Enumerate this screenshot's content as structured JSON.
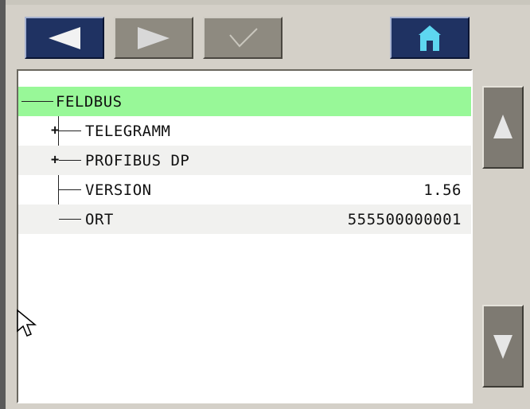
{
  "toolbar": {
    "back_icon": "arrow-left-icon",
    "forward_icon": "arrow-right-icon",
    "confirm_icon": "check-icon",
    "home_icon": "home-icon"
  },
  "tree": {
    "items": [
      {
        "label": "FELDBUS",
        "value": "",
        "selected": true,
        "expandable": false
      },
      {
        "label": "TELEGRAMM",
        "value": "",
        "selected": false,
        "expandable": true
      },
      {
        "label": "PROFIBUS DP",
        "value": "",
        "selected": false,
        "expandable": true
      },
      {
        "label": "VERSION",
        "value": "1.56",
        "selected": false,
        "expandable": false
      },
      {
        "label": "ORT",
        "value": "555500000001",
        "selected": false,
        "expandable": false
      }
    ]
  },
  "scroll": {
    "up_icon": "triangle-up-icon",
    "down_icon": "triangle-down-icon"
  },
  "colors": {
    "selected_row": "#98f898",
    "active_button": "#1f3262",
    "inactive_button": "#8e8a80",
    "home_roof": "#5ed7f0"
  }
}
